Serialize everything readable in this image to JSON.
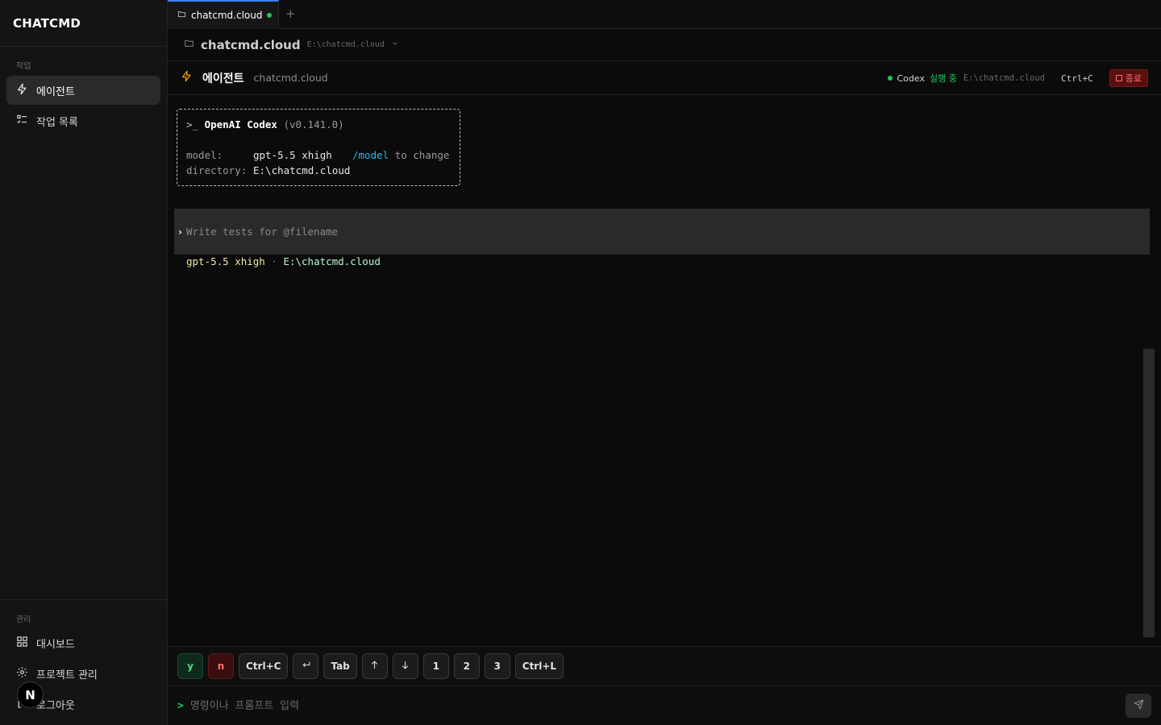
{
  "sidebar": {
    "brand": "CHATCMD",
    "section_work": "작업",
    "items": [
      {
        "label": "에이전트",
        "icon": "bolt-icon",
        "active": true
      },
      {
        "label": "작업 목록",
        "icon": "list-check-icon",
        "active": false
      }
    ],
    "section_admin": "관리",
    "admin_items": [
      {
        "label": "대시보드",
        "icon": "dashboard-icon"
      },
      {
        "label": "프로젝트 관리",
        "icon": "gear-icon"
      },
      {
        "label": "로그아웃",
        "icon": "logout-icon"
      }
    ],
    "avatar_letter": "N"
  },
  "tabs": [
    {
      "label": "chatcmd.cloud",
      "active": true,
      "status": "running"
    }
  ],
  "tab_add_label": "+",
  "pathbar": {
    "title": "chatcmd.cloud",
    "path": "E:\\chatcmd.cloud"
  },
  "agent_header": {
    "title": "에이전트",
    "project": "chatcmd.cloud",
    "status_name": "Codex",
    "status_text": "실행 중",
    "status_path": "E:\\chatcmd.cloud",
    "shortcut": "Ctrl+C",
    "stop_label": "종료"
  },
  "terminal": {
    "banner_prefix": ">_",
    "banner_title": "OpenAI Codex",
    "banner_version": "(v0.141.0)",
    "model_key": "model:",
    "model_value": "gpt-5.5 xhigh",
    "model_hint_cmd": "/model",
    "model_hint_text": "to change",
    "dir_key": "directory:",
    "dir_value": "E:\\chatcmd.cloud",
    "prompt_caret": "›",
    "prompt_placeholder": "Write tests for @filename",
    "footer_model": "gpt-5.5 xhigh",
    "footer_sep": "·",
    "footer_path": "E:\\chatcmd.cloud"
  },
  "keys": [
    "y",
    "n",
    "Ctrl+C",
    "↵",
    "Tab",
    "↑",
    "↓",
    "1",
    "2",
    "3",
    "Ctrl+L"
  ],
  "input": {
    "prefix": ">",
    "placeholder": "명령이나 프롬프트 입력",
    "value": ""
  },
  "colors": {
    "accent": "#3b82f6",
    "running": "#22c55e",
    "danger": "#f87171",
    "link": "#22b8e6"
  }
}
